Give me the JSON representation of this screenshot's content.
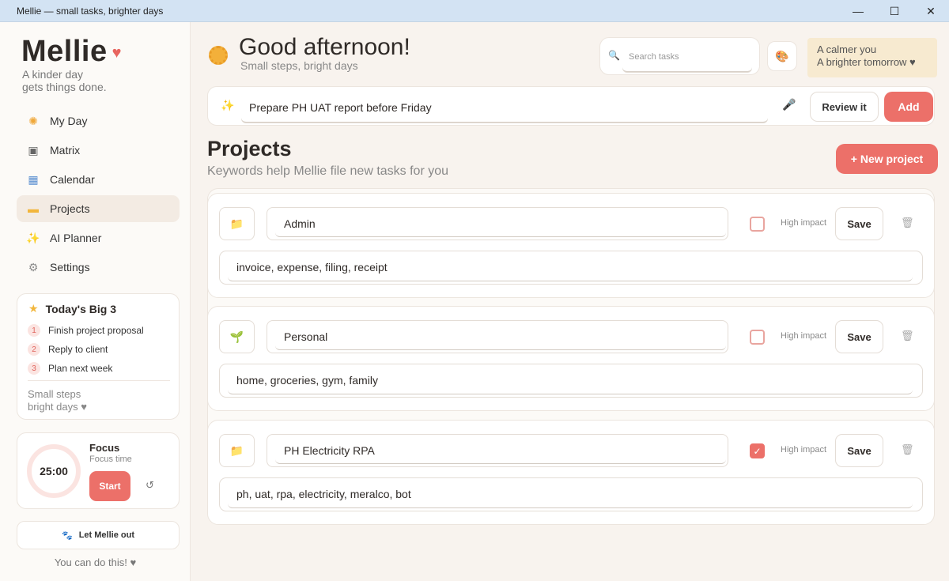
{
  "window": {
    "title": "Mellie — small tasks, brighter days",
    "controls": [
      "—",
      "☐",
      "✕"
    ]
  },
  "sidebar": {
    "brand": "Mellie",
    "brand_heart": "♥",
    "tagline_line1": "A kinder day",
    "tagline_line2": "gets things done.",
    "nav": [
      {
        "label": "My Day",
        "icon": "sun-icon",
        "glyph": "✺",
        "color": "#f0a83a"
      },
      {
        "label": "Matrix",
        "icon": "matrix-icon",
        "glyph": "▣",
        "color": "#666666"
      },
      {
        "label": "Calendar",
        "icon": "calendar-icon",
        "glyph": "▦",
        "color": "#5b8fd1"
      },
      {
        "label": "Projects",
        "icon": "folder-icon",
        "glyph": "▬",
        "color": "#f2b63c",
        "active": true
      },
      {
        "label": "AI Planner",
        "icon": "sparkle-icon",
        "glyph": "✨",
        "color": "#f2b63c"
      },
      {
        "label": "Settings",
        "icon": "gear-icon",
        "glyph": "⚙",
        "color": "#8a8a8a"
      }
    ],
    "big3": {
      "title": "Today's Big 3",
      "items": [
        {
          "num": "1",
          "text": "Finish project proposal"
        },
        {
          "num": "2",
          "text": "Reply to client"
        },
        {
          "num": "3",
          "text": "Plan next week"
        }
      ],
      "footer_line1": "Small steps",
      "footer_line2": "bright days ♥"
    },
    "focus": {
      "timer": "25:00",
      "title": "Focus",
      "subtitle": "Focus time",
      "start": "Start",
      "reset_glyph": "↺"
    },
    "let_out": "Let Mellie out",
    "cheer": "You can do this! ♥"
  },
  "header": {
    "greeting": "Good afternoon!",
    "subtitle": "Small steps, bright days",
    "search_placeholder": "Search tasks",
    "note_line1": "A calmer you",
    "note_line2": "A brighter tomorrow ♥"
  },
  "quick_add": {
    "value": "Prepare PH UAT report before Friday",
    "review": "Review it",
    "add": "Add"
  },
  "projects": {
    "title": "Projects",
    "subtitle": "Keywords help Mellie file new tasks for you",
    "new_button": "+ New project",
    "impact_label": "High impact",
    "save_label": "Save",
    "items": [
      {
        "name": "Admin",
        "icon": "folder-icon",
        "glyph": "📁",
        "high_impact": false,
        "keywords": "invoice, expense, filing, receipt"
      },
      {
        "name": "Personal",
        "icon": "sprout-icon",
        "glyph": "🌱",
        "high_impact": false,
        "keywords": "home, groceries, gym, family"
      },
      {
        "name": "PH Electricity RPA",
        "icon": "folder-icon",
        "glyph": "📁",
        "high_impact": true,
        "keywords": "ph, uat, rpa, electricity, meralco, bot"
      }
    ]
  },
  "colors": {
    "accent": "#ec7069",
    "background": "#f8f3ee",
    "note": "#f7ead0"
  }
}
